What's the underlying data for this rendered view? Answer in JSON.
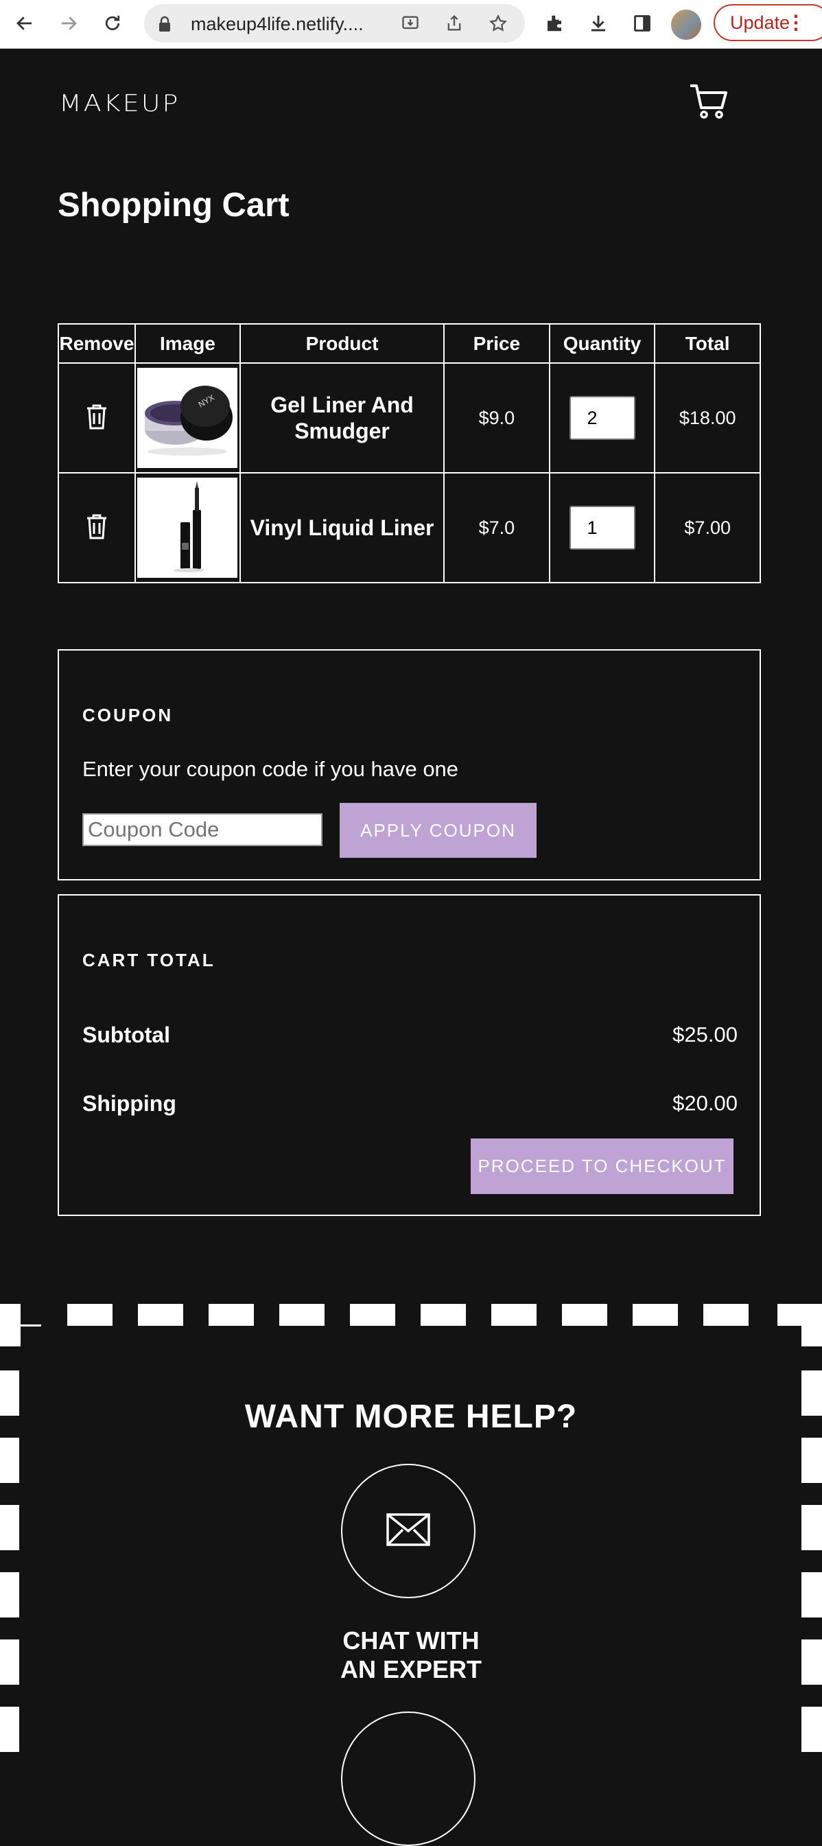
{
  "browser": {
    "url": "makeup4life.netlify....",
    "update_label": "Update"
  },
  "header": {
    "logo": "MAKEUP"
  },
  "page": {
    "title": "Shopping Cart"
  },
  "cart_table": {
    "headers": [
      "Remove",
      "Image",
      "Product",
      "Price",
      "Quantity",
      "Total"
    ],
    "rows": [
      {
        "product": "Gel Liner And Smudger",
        "price": "$9.0",
        "quantity": "2",
        "total": "$18.00"
      },
      {
        "product": "Vinyl Liquid Liner",
        "price": "$7.0",
        "quantity": "1",
        "total": "$7.00"
      }
    ]
  },
  "coupon": {
    "heading": "COUPON",
    "description": "Enter your coupon code if you have one",
    "placeholder": "Coupon Code",
    "apply_label": "APPLY COUPON"
  },
  "cart_total": {
    "heading": "CART TOTAL",
    "subtotal_label": "Subtotal",
    "subtotal_value": "$25.00",
    "shipping_label": "Shipping",
    "shipping_value": "$20.00",
    "checkout_label": "PROCEED TO CHECKOUT"
  },
  "help": {
    "title": "WANT MORE HELP?",
    "chat_line1": "CHAT WITH",
    "chat_line2": "AN EXPERT"
  },
  "colors": {
    "background": "#141314",
    "accent": "#bfa3d4",
    "update_red": "#b3261e"
  }
}
